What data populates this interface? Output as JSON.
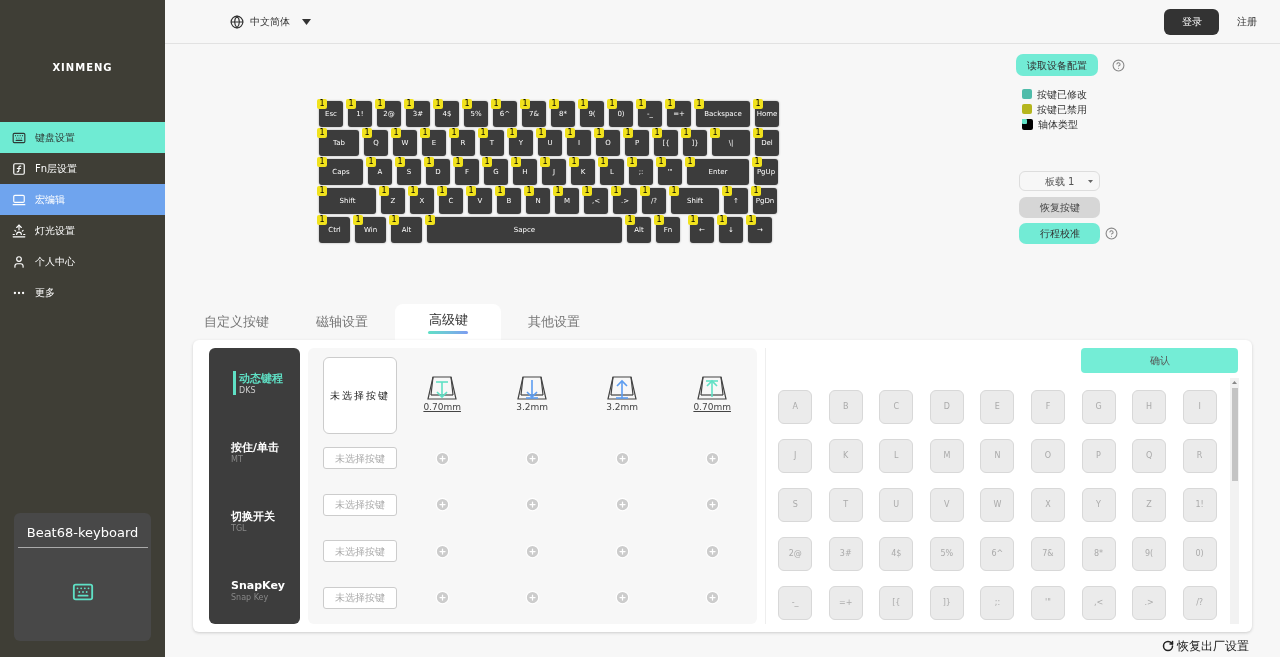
{
  "sidebar": {
    "logo": "XINMENG",
    "items": [
      {
        "label": "键盘设置",
        "kind": "keyboard",
        "selected": true,
        "hovered": false
      },
      {
        "label": "Fn层设置",
        "kind": "fn",
        "selected": false,
        "hovered": false
      },
      {
        "label": "宏编辑",
        "kind": "macro",
        "selected": false,
        "hovered": true
      },
      {
        "label": "灯光设置",
        "kind": "light",
        "selected": false,
        "hovered": false
      },
      {
        "label": "个人中心",
        "kind": "user",
        "selected": false,
        "hovered": false
      },
      {
        "label": "更多",
        "kind": "more",
        "selected": false,
        "hovered": false
      }
    ],
    "device_card": {
      "name": "Beat68-keyboard"
    }
  },
  "topbar": {
    "language": "中文简体",
    "login": "登录",
    "register": "注册"
  },
  "keyboard": {
    "key_rows": [
      {
        "keys": [
          {
            "label": "Esc",
            "badge": "1",
            "kind": "unit"
          },
          {
            "label": "1!",
            "badge": "1",
            "kind": "unit"
          },
          {
            "label": "2@",
            "badge": "1",
            "kind": "unit"
          },
          {
            "label": "3#",
            "badge": "1",
            "kind": "unit"
          },
          {
            "label": "4$",
            "badge": "1",
            "kind": "unit"
          },
          {
            "label": "5%",
            "badge": "1",
            "kind": "unit"
          },
          {
            "label": "6^",
            "badge": "1",
            "kind": "unit"
          },
          {
            "label": "7&",
            "badge": "1",
            "kind": "unit"
          },
          {
            "label": "8*",
            "badge": "1",
            "kind": "unit"
          },
          {
            "label": "9(",
            "badge": "1",
            "kind": "unit"
          },
          {
            "label": "0)",
            "badge": "1",
            "kind": "unit"
          },
          {
            "label": "-_",
            "badge": "1",
            "kind": "unit"
          },
          {
            "label": "=+",
            "badge": "1",
            "kind": "unit"
          },
          {
            "label": "Backspace",
            "badge": "1",
            "kind": "backspace"
          },
          {
            "label": "Home",
            "badge": "1",
            "kind": "unit"
          }
        ]
      },
      {
        "keys": [
          {
            "label": "Tab",
            "badge": "1",
            "kind": "tab"
          },
          {
            "label": "Q",
            "badge": "1",
            "kind": "unit"
          },
          {
            "label": "W",
            "badge": "1",
            "kind": "unit"
          },
          {
            "label": "E",
            "badge": "1",
            "kind": "unit"
          },
          {
            "label": "R",
            "badge": "1",
            "kind": "unit"
          },
          {
            "label": "T",
            "badge": "1",
            "kind": "unit"
          },
          {
            "label": "Y",
            "badge": "1",
            "kind": "unit"
          },
          {
            "label": "U",
            "badge": "1",
            "kind": "unit"
          },
          {
            "label": "I",
            "badge": "1",
            "kind": "unit"
          },
          {
            "label": "O",
            "badge": "1",
            "kind": "unit"
          },
          {
            "label": "P",
            "badge": "1",
            "kind": "unit"
          },
          {
            "label": "[{",
            "badge": "1",
            "kind": "unit"
          },
          {
            "label": "]}",
            "badge": "1",
            "kind": "unit"
          },
          {
            "label": "\\|",
            "badge": "1",
            "kind": "backslash"
          },
          {
            "label": "Del",
            "badge": "1",
            "kind": "unit"
          }
        ]
      },
      {
        "keys": [
          {
            "label": "Caps",
            "badge": "1",
            "kind": "caps"
          },
          {
            "label": "A",
            "badge": "1",
            "kind": "unit"
          },
          {
            "label": "S",
            "badge": "1",
            "kind": "unit"
          },
          {
            "label": "D",
            "badge": "1",
            "kind": "unit"
          },
          {
            "label": "F",
            "badge": "1",
            "kind": "unit"
          },
          {
            "label": "G",
            "badge": "1",
            "kind": "unit"
          },
          {
            "label": "H",
            "badge": "1",
            "kind": "unit"
          },
          {
            "label": "J",
            "badge": "1",
            "kind": "unit"
          },
          {
            "label": "K",
            "badge": "1",
            "kind": "unit"
          },
          {
            "label": "L",
            "badge": "1",
            "kind": "unit"
          },
          {
            "label": ";:",
            "badge": "1",
            "kind": "unit"
          },
          {
            "label": "'\"",
            "badge": "1",
            "kind": "unit"
          },
          {
            "label": "Enter",
            "badge": "1",
            "kind": "enter"
          },
          {
            "label": "PgUp",
            "badge": "1",
            "kind": "unit"
          }
        ]
      },
      {
        "keys": [
          {
            "label": "Shift",
            "badge": "1",
            "kind": "lshift"
          },
          {
            "label": "Z",
            "badge": "1",
            "kind": "unit"
          },
          {
            "label": "X",
            "badge": "1",
            "kind": "unit"
          },
          {
            "label": "C",
            "badge": "1",
            "kind": "unit"
          },
          {
            "label": "V",
            "badge": "1",
            "kind": "unit"
          },
          {
            "label": "B",
            "badge": "1",
            "kind": "unit"
          },
          {
            "label": "N",
            "badge": "1",
            "kind": "unit"
          },
          {
            "label": "M",
            "badge": "1",
            "kind": "unit"
          },
          {
            "label": ",<",
            "badge": "1",
            "kind": "unit"
          },
          {
            "label": ".>",
            "badge": "1",
            "kind": "unit"
          },
          {
            "label": "/?",
            "badge": "1",
            "kind": "unit"
          },
          {
            "label": "Shift",
            "badge": "1",
            "kind": "rshift"
          },
          {
            "label": "↑",
            "badge": "1",
            "kind": "unit"
          },
          {
            "label": "PgDn",
            "badge": "1",
            "kind": "unit"
          }
        ]
      },
      {
        "keys": [
          {
            "label": "Ctrl",
            "badge": "1",
            "kind": "mod"
          },
          {
            "label": "Win",
            "badge": "1",
            "kind": "mod"
          },
          {
            "label": "Alt",
            "badge": "1",
            "kind": "mod"
          },
          {
            "label": "Sapce",
            "badge": "1",
            "kind": "space"
          },
          {
            "label": "Alt",
            "badge": "1",
            "kind": "unit"
          },
          {
            "label": "Fn",
            "badge": "1",
            "kind": "unit"
          },
          {
            "label": "←",
            "badge": "1",
            "kind": "gap"
          },
          {
            "label": "↓",
            "badge": "1",
            "kind": "unit"
          },
          {
            "label": "→",
            "badge": "1",
            "kind": "unit"
          }
        ]
      }
    ]
  },
  "side_panel": {
    "read_config": "读取设备配置",
    "legend": [
      {
        "label": "按键已修改",
        "kind": "swatch",
        "color": "#4fbcaa"
      },
      {
        "label": "按键已禁用",
        "kind": "swatch",
        "color": "#b5b61e"
      },
      {
        "label": "轴体类型",
        "kind": "switch"
      }
    ],
    "profile": "板载 1",
    "restore_keys": "恢复按键",
    "calibrate": "行程校准"
  },
  "tabs": [
    {
      "label": "自定义按键",
      "selected": false
    },
    {
      "label": "磁轴设置",
      "selected": false
    },
    {
      "label": "高级键",
      "selected": true
    },
    {
      "label": "其他设置",
      "selected": false
    }
  ],
  "advanced": {
    "modes": [
      {
        "title": "动态键程",
        "subtitle": "DKS",
        "selected": true
      },
      {
        "title": "按住/单击",
        "subtitle": "MT",
        "selected": false
      },
      {
        "title": "切换开关",
        "subtitle": "TGL",
        "selected": false
      },
      {
        "title": "SnapKey",
        "subtitle": "Snap Key",
        "selected": false
      }
    ],
    "main_slot": "未选择按键",
    "stages": [
      {
        "kind": "press_start",
        "value": "0.70mm",
        "underlined": true
      },
      {
        "kind": "press_end",
        "value": "3.2mm",
        "underlined": false
      },
      {
        "kind": "release_start",
        "value": "3.2mm",
        "underlined": false
      },
      {
        "kind": "release_end",
        "value": "0.70mm",
        "underlined": true
      }
    ],
    "slots": [
      "未选择按键",
      "未选择按键",
      "未选择按键",
      "未选择按键"
    ]
  },
  "key_picker": {
    "confirm": "确认",
    "keys": [
      "A",
      "B",
      "C",
      "D",
      "E",
      "F",
      "G",
      "H",
      "I",
      "J",
      "K",
      "L",
      "M",
      "N",
      "O",
      "P",
      "Q",
      "R",
      "S",
      "T",
      "U",
      "V",
      "W",
      "X",
      "Y",
      "Z",
      "1!",
      "2@",
      "3#",
      "4$",
      "5%",
      "6^",
      "7&",
      "8*",
      "9(",
      "0)",
      "-_",
      "=+",
      "[{",
      "]}",
      ";:",
      "'\"",
      ",<",
      ".>",
      "/?"
    ]
  },
  "footer": {
    "reset": "恢复出厂设置"
  }
}
